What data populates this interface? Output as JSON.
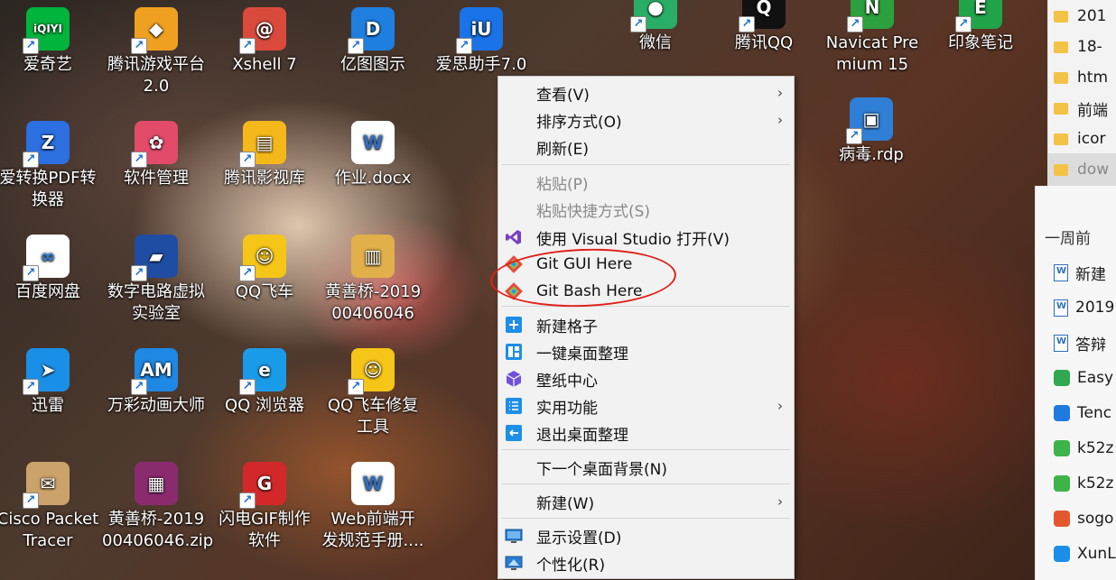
{
  "desktop": {
    "icons": [
      {
        "label": "爱奇艺",
        "icon": "iqiyi-icon",
        "glyph": "iQIYI",
        "color": "#00b43c"
      },
      {
        "label": "腾讯游戏平台\n2.0",
        "icon": "tencent-game-icon",
        "glyph": "◆",
        "color": "#f0a020"
      },
      {
        "label": "Xshell 7",
        "icon": "xshell-icon",
        "glyph": "@",
        "color": "#d94a3d"
      },
      {
        "label": "亿图图示",
        "icon": "edraw-icon",
        "glyph": "D",
        "color": "#1e7fe0"
      },
      {
        "label": "爱思助手7.0",
        "icon": "i4-icon",
        "glyph": "iU",
        "color": "#1a73e8"
      },
      {
        "label": "微信",
        "icon": "wechat-icon",
        "glyph": "●",
        "color": "#2aae67"
      },
      {
        "label": "腾讯QQ",
        "icon": "qq-icon",
        "glyph": "Q",
        "color": "#111111"
      },
      {
        "label": "Navicat Pre\nmium 15",
        "icon": "navicat-icon",
        "glyph": "N",
        "color": "#2c9f3e"
      },
      {
        "label": "印象笔记",
        "icon": "evernote-icon",
        "glyph": "E",
        "color": "#21a34a"
      },
      {
        "label": "爱转换PDF转\n换器",
        "icon": "pdf-converter-icon",
        "glyph": "Z",
        "color": "#2b6fe0"
      },
      {
        "label": "软件管理",
        "icon": "software-manager-icon",
        "glyph": "✿",
        "color": "#e24b6a"
      },
      {
        "label": "腾讯影视库",
        "icon": "tencent-video-library-icon",
        "glyph": "▤",
        "color": "#f5b81b"
      },
      {
        "label": "作业.docx",
        "icon": "word-document-icon",
        "glyph": "W",
        "color": "#ffffff"
      },
      {
        "label": "病毒.rdp",
        "icon": "remote-desktop-icon",
        "glyph": "▣",
        "color": "#2f7fd6"
      },
      {
        "label": "百度网盘",
        "icon": "baidu-netdisk-icon",
        "glyph": "∞",
        "color": "#ffffff"
      },
      {
        "label": "数字电路虚拟\n实验室",
        "icon": "digital-circuit-lab-icon",
        "glyph": "▰",
        "color": "#1e4da3"
      },
      {
        "label": "QQ飞车",
        "icon": "qq-speed-icon",
        "glyph": "☺",
        "color": "#f5c518"
      },
      {
        "label": "黄善桥-2019\n00406046",
        "icon": "zip-folder-icon",
        "glyph": "▥",
        "color": "#e2b04a"
      },
      {
        "label": "迅雷",
        "icon": "thunder-icon",
        "glyph": "➤",
        "color": "#1a8fe8"
      },
      {
        "label": "万彩动画大师",
        "icon": "animation-master-icon",
        "glyph": "AM",
        "color": "#1e88e5"
      },
      {
        "label": "QQ 浏览器",
        "icon": "qq-browser-icon",
        "glyph": "e",
        "color": "#1a9be8"
      },
      {
        "label": "QQ飞车修复\n工具",
        "icon": "qq-speed-repair-icon",
        "glyph": "☺",
        "color": "#f5c518"
      },
      {
        "label": "Cisco Packet\nTracer",
        "icon": "cisco-packet-tracer-icon",
        "glyph": "✉",
        "color": "#caa26a"
      },
      {
        "label": "黄善桥-2019\n00406046.zip",
        "icon": "winrar-icon",
        "glyph": "▦",
        "color": "#8a2b6e"
      },
      {
        "label": "闪电GIF制作\n软件",
        "icon": "gif-maker-icon",
        "glyph": "G",
        "color": "#d3282a"
      },
      {
        "label": "Web前端开\n发规范手册....",
        "icon": "word-document-icon",
        "glyph": "W",
        "color": "#ffffff"
      }
    ],
    "partial_label": "工"
  },
  "context_menu": {
    "items": [
      {
        "label": "查看(V)",
        "submenu": true,
        "disabled": false,
        "icon": ""
      },
      {
        "label": "排序方式(O)",
        "submenu": true,
        "disabled": false,
        "icon": ""
      },
      {
        "label": "刷新(E)",
        "submenu": false,
        "disabled": false,
        "icon": ""
      },
      {
        "label": "粘贴(P)",
        "submenu": false,
        "disabled": true,
        "icon": ""
      },
      {
        "label": "粘贴快捷方式(S)",
        "submenu": false,
        "disabled": true,
        "icon": ""
      },
      {
        "label": "使用 Visual Studio 打开(V)",
        "submenu": false,
        "disabled": false,
        "icon": "visual-studio-icon"
      },
      {
        "label": "Git GUI Here",
        "submenu": false,
        "disabled": false,
        "icon": "git-icon"
      },
      {
        "label": "Git Bash Here",
        "submenu": false,
        "disabled": false,
        "icon": "git-icon"
      },
      {
        "label": "新建格子",
        "submenu": false,
        "disabled": false,
        "icon": "add-box-icon"
      },
      {
        "label": "一键桌面整理",
        "submenu": false,
        "disabled": false,
        "icon": "layout-grid-icon"
      },
      {
        "label": "壁纸中心",
        "submenu": false,
        "disabled": false,
        "icon": "cube-icon"
      },
      {
        "label": "实用功能",
        "submenu": true,
        "disabled": false,
        "icon": "list-icon"
      },
      {
        "label": "退出桌面整理",
        "submenu": false,
        "disabled": false,
        "icon": "exit-icon"
      },
      {
        "label": "下一个桌面背景(N)",
        "submenu": false,
        "disabled": false,
        "icon": ""
      },
      {
        "label": "新建(W)",
        "submenu": true,
        "disabled": false,
        "icon": ""
      },
      {
        "label": "显示设置(D)",
        "submenu": false,
        "disabled": false,
        "icon": "display-icon"
      },
      {
        "label": "个性化(R)",
        "submenu": false,
        "disabled": false,
        "icon": "personalize-icon"
      }
    ],
    "arrow": "›"
  },
  "right_panel": {
    "folders": [
      "201",
      "18-",
      "htm",
      "前端",
      "icor",
      "dow"
    ],
    "section_title": "一周前",
    "recent": [
      {
        "label": "新建",
        "kind": "doc"
      },
      {
        "label": "2019",
        "kind": "doc"
      },
      {
        "label": "答辩",
        "kind": "txt"
      },
      {
        "label": "Easy",
        "kind": "app",
        "color": "#2fa84f"
      },
      {
        "label": "Tenc",
        "kind": "app",
        "color": "#1f7ae0"
      },
      {
        "label": "k52z",
        "kind": "app",
        "color": "#3db34a"
      },
      {
        "label": "k52z",
        "kind": "app",
        "color": "#3db34a"
      },
      {
        "label": "sogo",
        "kind": "app",
        "color": "#e4572e"
      },
      {
        "label": "XunL",
        "kind": "app",
        "color": "#1a8fe8"
      }
    ]
  },
  "annotation_color": "#e0201a"
}
